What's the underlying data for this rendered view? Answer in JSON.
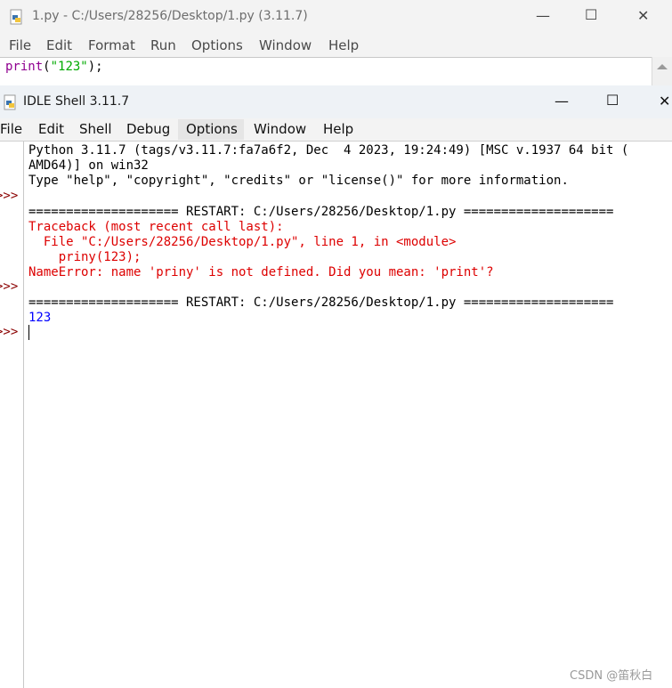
{
  "editor": {
    "title": "1.py - C:/Users/28256/Desktop/1.py (3.11.7)",
    "menu": [
      "File",
      "Edit",
      "Format",
      "Run",
      "Options",
      "Window",
      "Help"
    ],
    "code": {
      "fn": "print",
      "open": "(",
      "str": "\"123\"",
      "close": ");"
    },
    "controls": {
      "minimize": "—",
      "maximize": "☐",
      "close": "✕"
    }
  },
  "shell": {
    "title": "IDLE Shell 3.11.7",
    "menu": [
      "File",
      "Edit",
      "Shell",
      "Debug",
      "Options",
      "Window",
      "Help"
    ],
    "controls": {
      "minimize": "—",
      "maximize": "☐",
      "close": "✕"
    },
    "banner": [
      "Python 3.11.7 (tags/v3.11.7:fa7a6f2, Dec  4 2023, 19:24:49) [MSC v.1937 64 bit (",
      "AMD64)] on win32",
      "Type \"help\", \"copyright\", \"credits\" or \"license()\" for more information."
    ],
    "prompt": ">>>",
    "restart_line": "==================== RESTART: C:/Users/28256/Desktop/1.py ====================",
    "traceback": [
      "Traceback (most recent call last):",
      "  File \"C:/Users/28256/Desktop/1.py\", line 1, in <module>",
      "    priny(123);",
      "NameError: name 'priny' is not defined. Did you mean: 'print'?"
    ],
    "output": "123"
  },
  "watermark": "CSDN @笛秋白",
  "colors": {
    "keyword_builtin": "#900090",
    "string": "#00aa00",
    "error": "#dd0000",
    "stdout": "#0000ff",
    "prompt": "#8b0000"
  }
}
